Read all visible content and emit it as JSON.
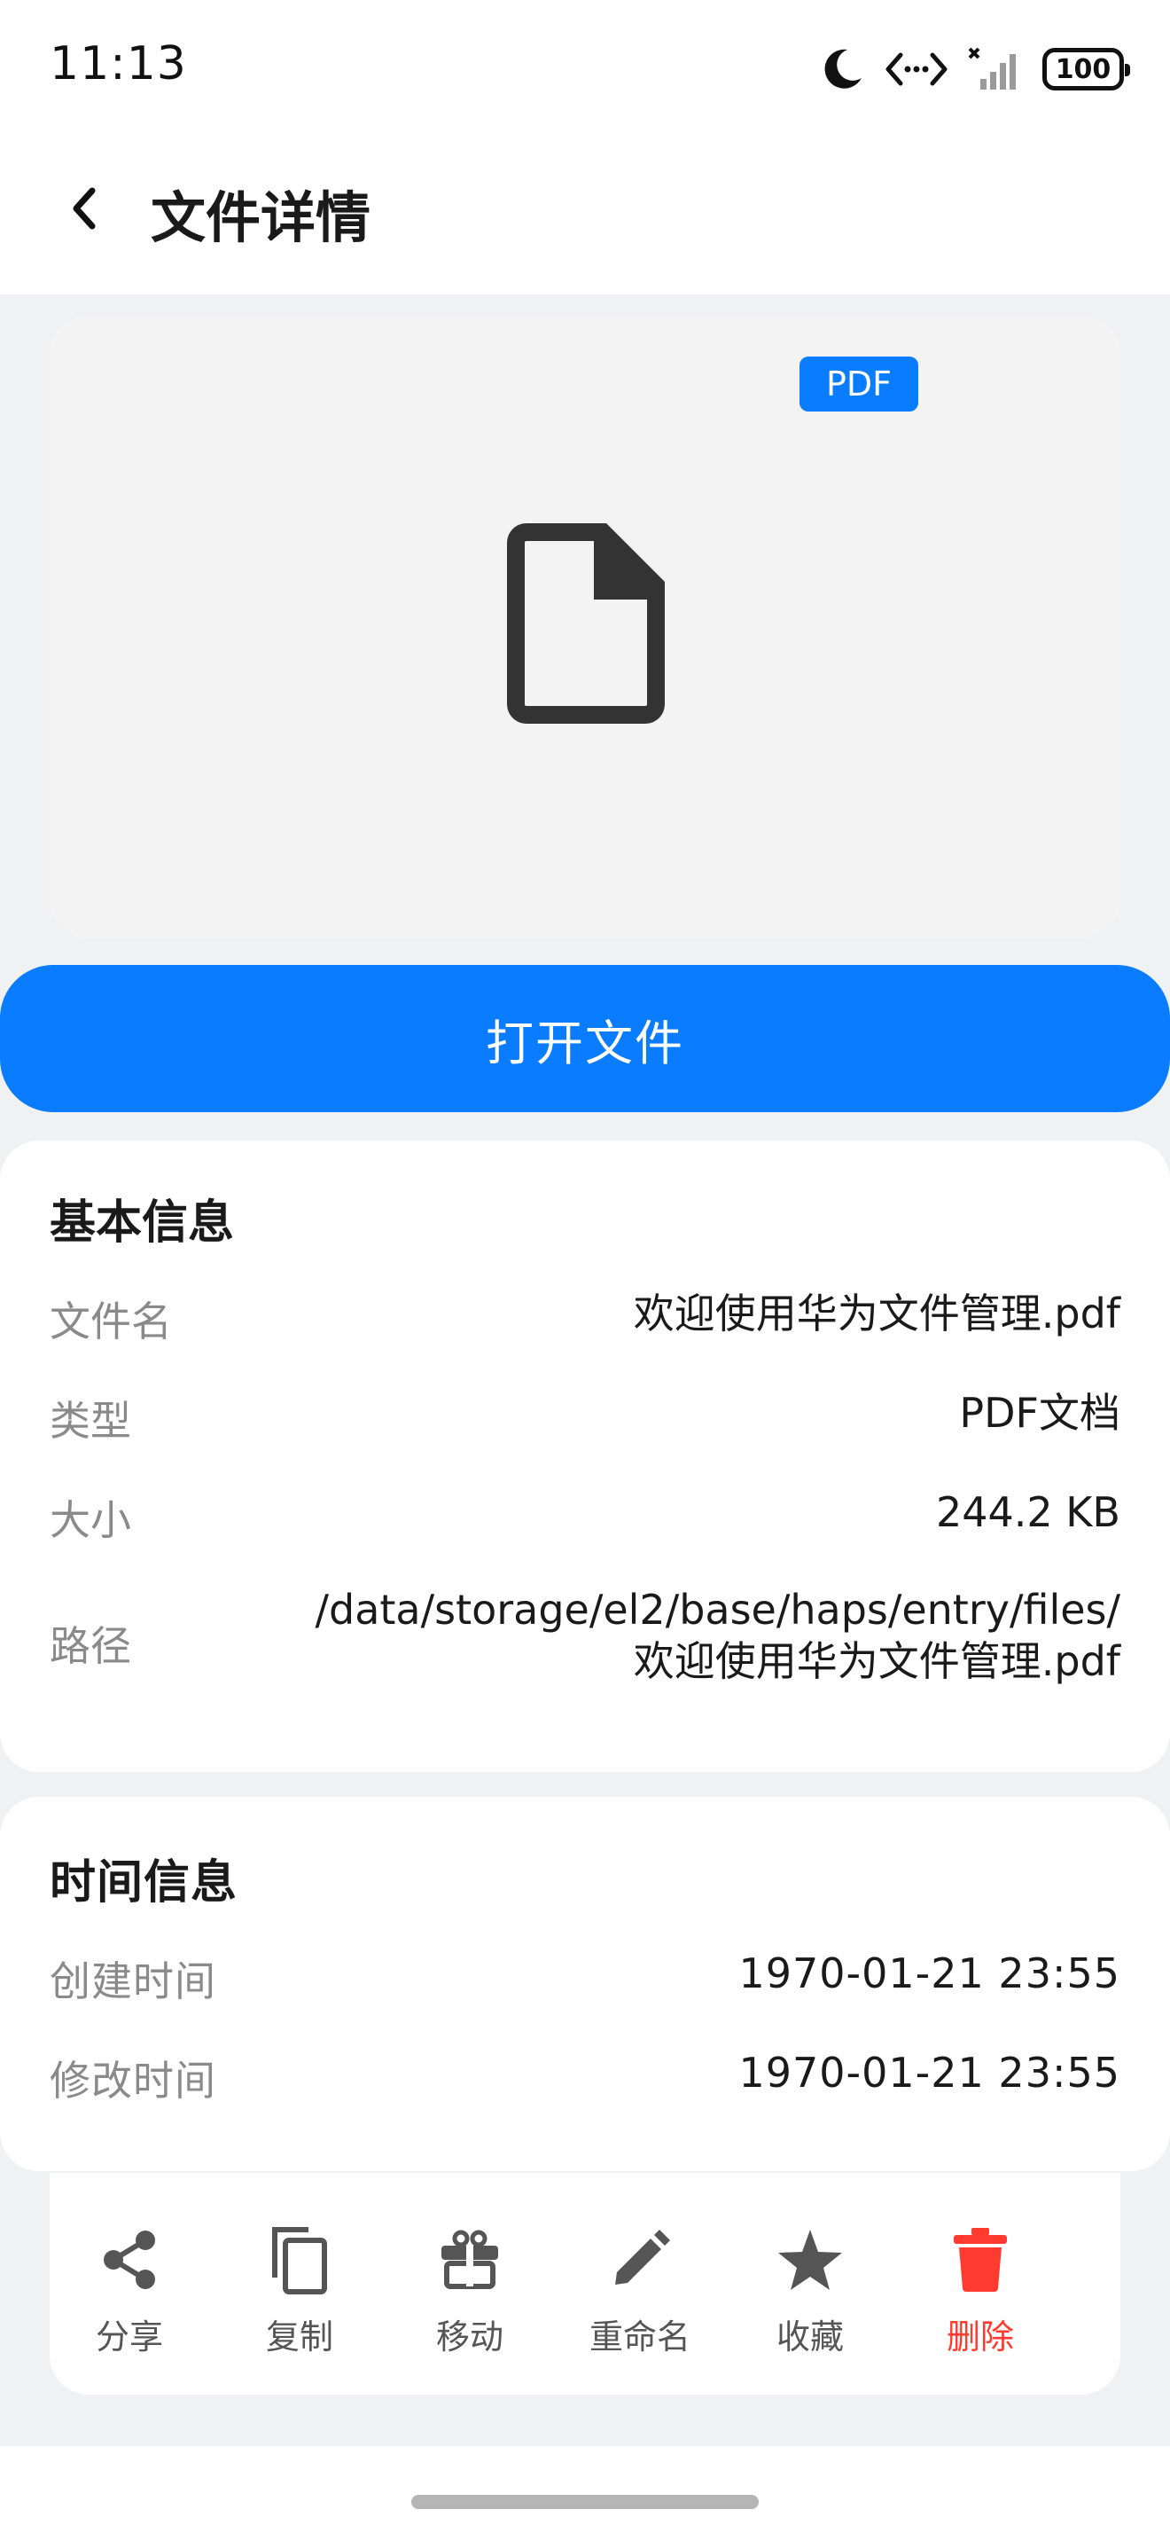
{
  "status_bar": {
    "time": "11:13",
    "battery": "100"
  },
  "header": {
    "title": "文件详情"
  },
  "preview": {
    "badge": "PDF"
  },
  "open_button": {
    "label": "打开文件"
  },
  "basic_info": {
    "title": "基本信息",
    "rows": [
      {
        "label": "文件名",
        "value": "欢迎使用华为文件管理.pdf"
      },
      {
        "label": "类型",
        "value": "PDF文档"
      },
      {
        "label": "大小",
        "value": "244.2 KB"
      },
      {
        "label": "路径",
        "value_line1": "/data/storage/el2/base/haps/entry/files/",
        "value_line2": "欢迎使用华为文件管理.pdf"
      }
    ]
  },
  "time_info": {
    "title": "时间信息",
    "rows": [
      {
        "label": "创建时间",
        "value": "1970-01-21 23:55"
      },
      {
        "label": "修改时间",
        "value": "1970-01-21 23:55"
      }
    ]
  },
  "actions": [
    {
      "label": "分享",
      "icon": "share-icon"
    },
    {
      "label": "复制",
      "icon": "copy-icon"
    },
    {
      "label": "移动",
      "icon": "move-icon"
    },
    {
      "label": "重命名",
      "icon": "pencil-icon"
    },
    {
      "label": "收藏",
      "icon": "star-icon"
    },
    {
      "label": "删除",
      "icon": "trash-icon"
    }
  ],
  "colors": {
    "accent": "#0a7cff",
    "danger": "#ff3b30",
    "background": "#f0f1f3"
  }
}
